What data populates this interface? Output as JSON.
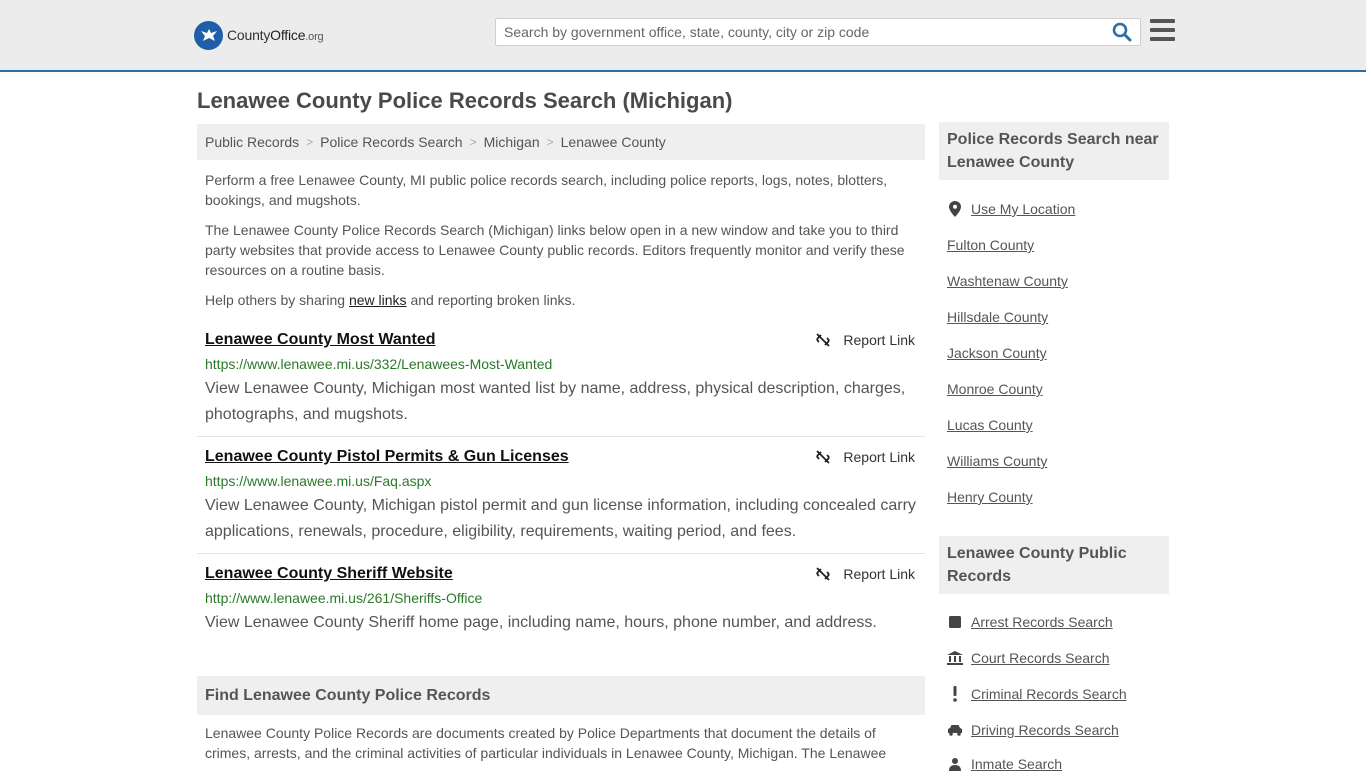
{
  "header": {
    "logo_text_main": "County",
    "logo_text_bold": "Office",
    "logo_text_tld": ".org",
    "search_placeholder": "Search by government office, state, county, city or zip code"
  },
  "page": {
    "title": "Lenawee County Police Records Search (Michigan)"
  },
  "breadcrumb": [
    "Public Records",
    "Police Records Search",
    "Michigan",
    "Lenawee County"
  ],
  "intro": {
    "p1": "Perform a free Lenawee County, MI public police records search, including police reports, logs, notes, blotters, bookings, and mugshots.",
    "p2": "The Lenawee County Police Records Search (Michigan) links below open in a new window and take you to third party websites that provide access to Lenawee County public records. Editors frequently monitor and verify these resources on a routine basis.",
    "p3_before": "Help others by sharing ",
    "p3_link": "new links",
    "p3_after": " and reporting broken links."
  },
  "report_link_label": "Report Link",
  "entries": [
    {
      "title": "Lenawee County Most Wanted",
      "url": "https://www.lenawee.mi.us/332/Lenawees-Most-Wanted",
      "description": "View Lenawee County, Michigan most wanted list by name, address, physical description, charges, photographs, and mugshots."
    },
    {
      "title": "Lenawee County Pistol Permits & Gun Licenses",
      "url": "https://www.lenawee.mi.us/Faq.aspx",
      "description": "View Lenawee County, Michigan pistol permit and gun license information, including concealed carry applications, renewals, procedure, eligibility, requirements, waiting period, and fees."
    },
    {
      "title": "Lenawee County Sheriff Website",
      "url": "http://www.lenawee.mi.us/261/Sheriffs-Office",
      "description": "View Lenawee County Sheriff home page, including name, hours, phone number, and address."
    }
  ],
  "find": {
    "heading": "Find Lenawee County Police Records",
    "text": "Lenawee County Police Records are documents created by Police Departments that document the details of crimes, arrests, and the criminal activities of particular individuals in Lenawee County, Michigan. The Lenawee"
  },
  "sidebar": {
    "nearby_heading": "Police Records Search near Lenawee County",
    "use_location": "Use My Location",
    "nearby": [
      "Fulton County",
      "Washtenaw County",
      "Hillsdale County",
      "Jackson County",
      "Monroe County",
      "Lucas County",
      "Williams County",
      "Henry County"
    ],
    "public_heading": "Lenawee County Public Records",
    "public_links": [
      {
        "label": "Arrest Records Search",
        "icon": "square-icon"
      },
      {
        "label": "Court Records Search",
        "icon": "courthouse-icon"
      },
      {
        "label": "Criminal Records Search",
        "icon": "exclamation-icon"
      },
      {
        "label": "Driving Records Search",
        "icon": "car-icon"
      },
      {
        "label": "Inmate Search",
        "icon": "inmate-icon"
      }
    ]
  },
  "colors": {
    "accent_border": "#2e6da4",
    "url_green": "#2a7a2a",
    "logo_blue": "#1f5fa8"
  }
}
